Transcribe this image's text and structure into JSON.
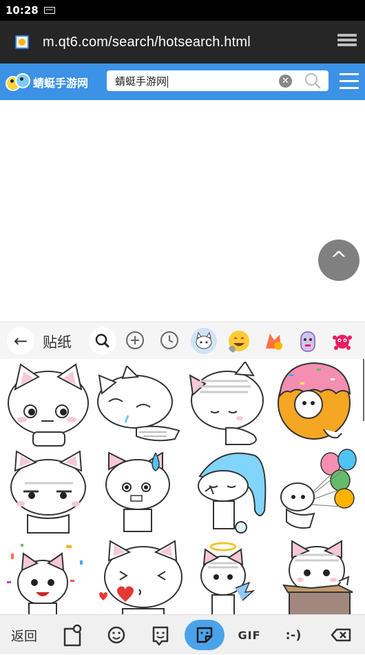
{
  "status_bar": {
    "time": "10:28"
  },
  "browser": {
    "url": "m.qt6.com/search/hotsearch.html"
  },
  "site": {
    "logo_text": "蜻蜓手游网",
    "search_value": "蜻蜓手游网",
    "header_color": "#3c92e6"
  },
  "back_to_top": {
    "label": "^"
  },
  "sticker_panel": {
    "title": "贴纸",
    "categories": [
      "cat-sticker",
      "smile-emoji",
      "dancing-character",
      "purple-character",
      "red-monster"
    ]
  },
  "stickers": [
    "cat-sitting",
    "cat-lying-crying",
    "cat-sad-kneeling",
    "cat-in-donut",
    "cat-annoyed",
    "cat-sweating",
    "cat-nightcap",
    "cat-balloons",
    "cat-confetti",
    "cat-hearts-kiss",
    "cat-halo",
    "cat-in-box"
  ],
  "bottom_toolbar": {
    "return_label": "返回",
    "gif_label": "GIF",
    "emoticon_label": ":-)",
    "active_color": "#4aa3ea"
  }
}
